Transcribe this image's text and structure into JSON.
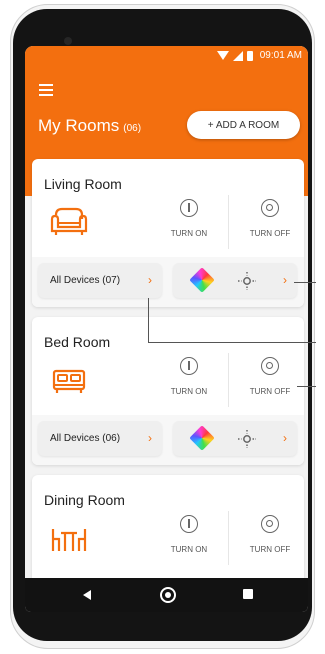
{
  "status_bar": {
    "time": "09:01 AM"
  },
  "header": {
    "title": "My Rooms",
    "count": "(06)",
    "add_room_label": "+ ADD A ROOM"
  },
  "rooms": [
    {
      "name": "Living Room",
      "turn_on_label": "TURN ON",
      "turn_off_label": "TURN OFF",
      "all_devices_label": "All Devices (07)",
      "arrow": "›",
      "controls_arrow": "›"
    },
    {
      "name": "Bed Room",
      "turn_on_label": "TURN ON",
      "turn_off_label": "TURN OFF",
      "all_devices_label": "All Devices (06)",
      "arrow": "›",
      "controls_arrow": "›"
    },
    {
      "name": "Dining Room",
      "turn_on_label": "TURN ON",
      "turn_off_label": "TURN OFF"
    }
  ],
  "colors": {
    "accent": "#f36f0f",
    "text": "#222222"
  },
  "icons": {
    "menu": "menu-icon",
    "sofa": "sofa-icon",
    "bed": "bed-icon",
    "dining": "dining-table-icon",
    "power": "power-icon",
    "off": "power-off-icon",
    "color": "color-picker-icon",
    "brightness": "brightness-icon"
  }
}
